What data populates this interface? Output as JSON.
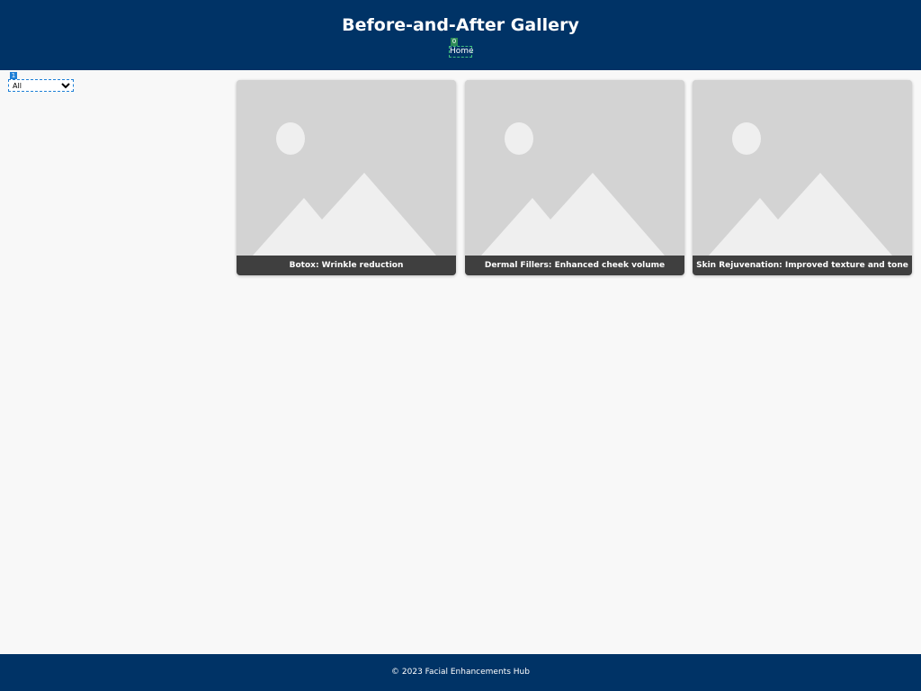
{
  "header": {
    "title": "Before-and-After Gallery",
    "nav_home_label": "Home",
    "nav_home_badge": "0"
  },
  "filter": {
    "badge": "1",
    "selected": "All",
    "options": [
      "All"
    ]
  },
  "gallery": {
    "items": [
      {
        "caption": "Botox: Wrinkle reduction",
        "image_icon": "image-placeholder-icon"
      },
      {
        "caption": "Dermal Fillers: Enhanced cheek volume",
        "image_icon": "image-placeholder-icon"
      },
      {
        "caption": "Skin Rejuvenation: Improved texture and tone",
        "image_icon": "image-placeholder-icon"
      }
    ]
  },
  "footer": {
    "text": "© 2023 Facial Enhancements Hub"
  },
  "colors": {
    "header_bg": "#003366",
    "page_bg": "#f8f8f8",
    "caption_bg": "#3f3f3f",
    "placeholder_bg": "#d3d3d3",
    "placeholder_fg": "#efefef"
  }
}
